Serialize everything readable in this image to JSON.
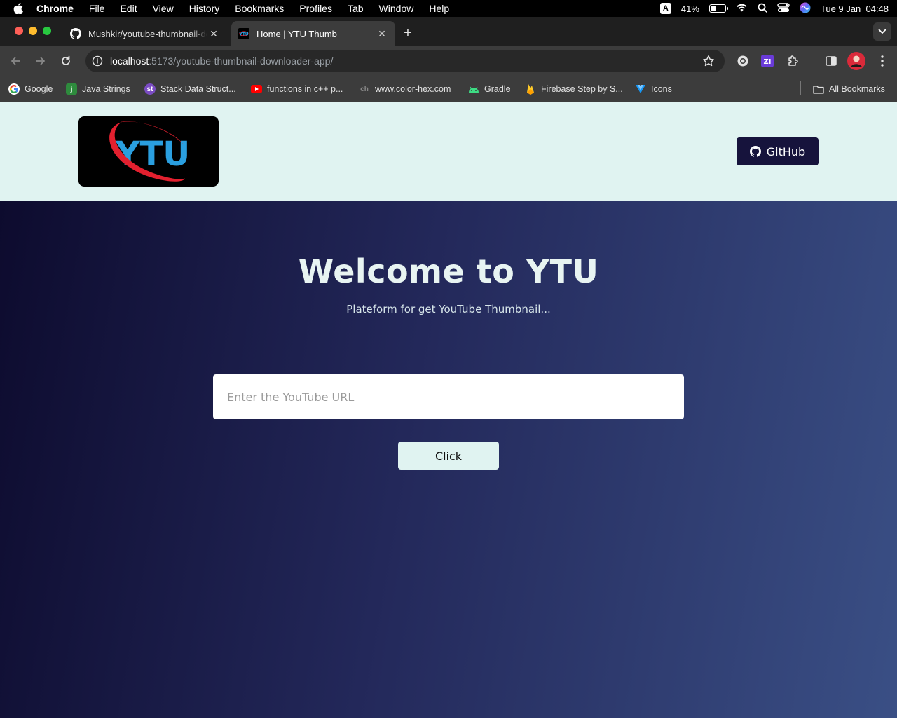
{
  "os_menubar": {
    "app_name": "Chrome",
    "menus": [
      "File",
      "Edit",
      "View",
      "History",
      "Bookmarks",
      "Profiles",
      "Tab",
      "Window",
      "Help"
    ],
    "input_source": "A",
    "battery_percent": "41%",
    "battery_level": 0.41,
    "datetime": "Tue 9 Jan  04:48"
  },
  "browser": {
    "tabs": [
      {
        "title": "Mushkir/youtube-thumbnail-downloader-app",
        "icon": "github-icon",
        "active": false
      },
      {
        "title": "Home | YTU Thumb",
        "icon": "ytu-favicon",
        "active": true
      }
    ],
    "address_bar": {
      "host": "localhost",
      "path": ":5173/youtube-thumbnail-downloader-app/"
    },
    "bookmarks": [
      {
        "label": "Google",
        "icon": "google-icon"
      },
      {
        "label": "Java Strings",
        "icon": "java-icon"
      },
      {
        "label": "Stack Data Struct...",
        "icon": "st-icon"
      },
      {
        "label": "functions in c++ p...",
        "icon": "youtube-icon"
      },
      {
        "label": "www.color-hex.com",
        "icon": "colorhex-icon"
      },
      {
        "label": "Gradle",
        "icon": "android-icon"
      },
      {
        "label": "Firebase Step by S...",
        "icon": "firebase-icon"
      },
      {
        "label": "Icons",
        "icon": "vuetify-icon"
      }
    ],
    "all_bookmarks_label": "All Bookmarks"
  },
  "site": {
    "header": {
      "logo_text": "YTU",
      "github_label": "GitHub"
    },
    "hero": {
      "title": "Welcome to YTU",
      "subtitle": "Plateform for get YouTube Thumbnail..."
    },
    "form": {
      "url_placeholder": "Enter the YouTube URL",
      "url_value": "",
      "submit_label": "Click"
    }
  },
  "colors": {
    "header_bg": "#e0f3f1",
    "github_button_bg": "#16133c",
    "hero_gradient_start": "#0d0b2e",
    "hero_gradient_end": "#3a4f85",
    "logo_accent_red": "#e3202f",
    "logo_accent_blue": "#2a9fe0"
  }
}
